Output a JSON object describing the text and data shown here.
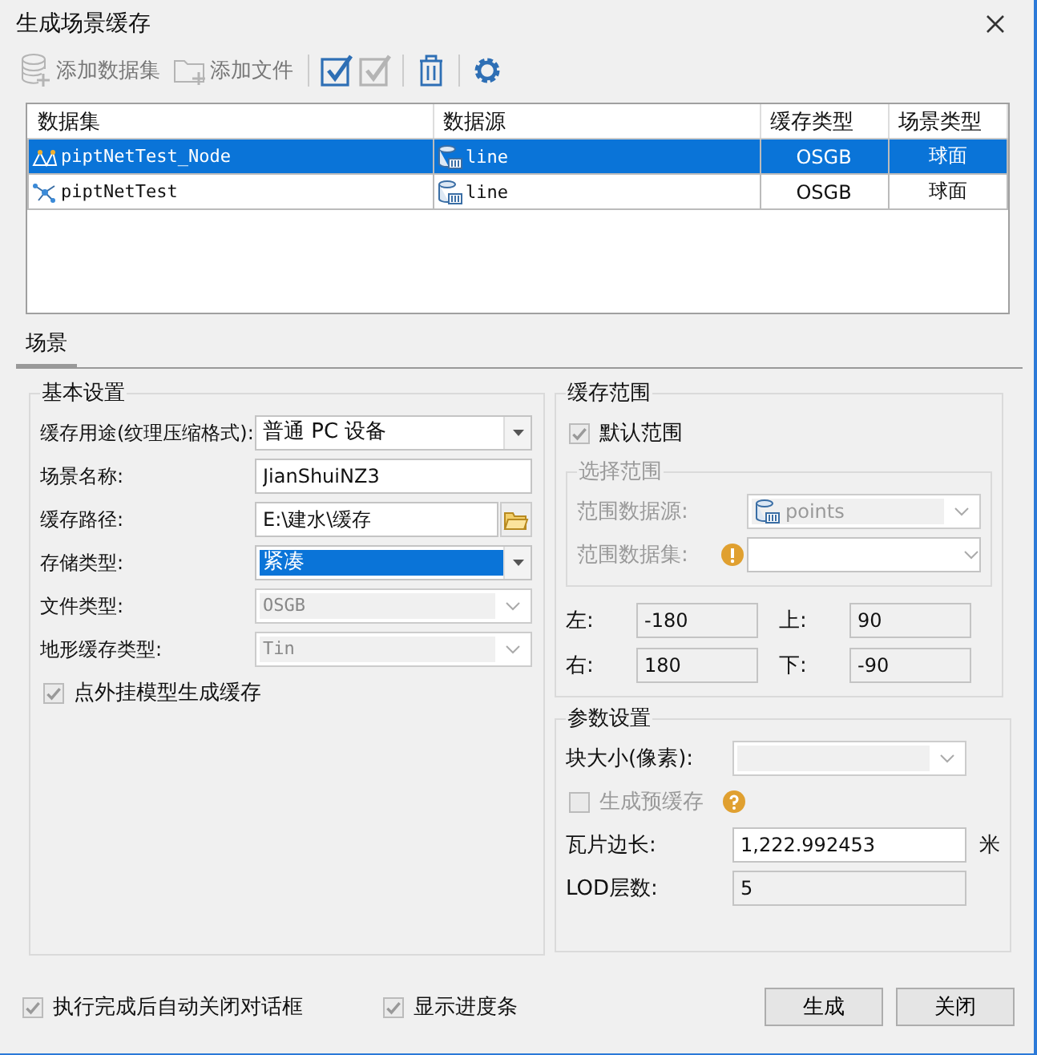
{
  "window": {
    "title": "生成场景缓存"
  },
  "toolbar": [
    {
      "kind": "add-dataset",
      "label": "添加数据集",
      "disabled": true
    },
    {
      "kind": "add-file",
      "label": "添加文件",
      "disabled": true
    },
    {
      "kind": "select-all",
      "disabled": false
    },
    {
      "kind": "invert-select",
      "disabled": true
    },
    {
      "kind": "delete",
      "disabled": false
    },
    {
      "kind": "settings",
      "disabled": false
    }
  ],
  "table": {
    "columns": [
      "数据集",
      "数据源",
      "缓存类型",
      "场景类型"
    ],
    "rows": [
      {
        "kind": "point",
        "selected": true,
        "cells": [
          "piptNetTest_Node",
          "line",
          "OSGB",
          "球面"
        ]
      },
      {
        "kind": "network",
        "selected": false,
        "cells": [
          "piptNetTest",
          "line",
          "OSGB",
          "球面"
        ]
      }
    ]
  },
  "tabs": [
    {
      "label": "场景",
      "selected": true
    }
  ],
  "basic_settings": {
    "title": "基本设置",
    "fields": [
      {
        "kind": "combo",
        "label": "缓存用途(纹理压缩格式):",
        "value": "普通 PC 设备",
        "disabled": false,
        "focused": false
      },
      {
        "kind": "text",
        "label": "场景名称:",
        "value": "JianShuiNZ3"
      },
      {
        "kind": "browse",
        "label": "缓存路径:",
        "value": "E:\\建水\\缓存"
      },
      {
        "kind": "combo",
        "label": "存储类型:",
        "value": "紧凑",
        "disabled": false,
        "focused": true
      },
      {
        "kind": "combo",
        "label": "文件类型:",
        "value": "OSGB",
        "disabled": true,
        "focused": false
      },
      {
        "kind": "combo",
        "label": "地形缓存类型:",
        "value": "Tin",
        "disabled": true,
        "focused": false
      },
      {
        "kind": "checkbox",
        "label": "点外挂模型生成缓存",
        "checked": true,
        "disabled": true
      }
    ]
  },
  "cache_extent": {
    "title": "缓存范围",
    "default_extent": {
      "label": "默认范围",
      "checked": true,
      "disabled": true
    },
    "select_range": {
      "title": "选择范围",
      "fields": [
        {
          "kind": "datasource",
          "label": "范围数据源:",
          "value": "points"
        },
        {
          "kind": "warning",
          "label": "范围数据集:"
        }
      ]
    },
    "bounds": [
      {
        "label": "左:",
        "value": "-180"
      },
      {
        "label": "上:",
        "value": "90"
      },
      {
        "label": "右:",
        "value": "180"
      },
      {
        "label": "下:",
        "value": "-90"
      }
    ]
  },
  "parameters": {
    "title": "参数设置",
    "fields": [
      {
        "kind": "combo",
        "label": "块大小(像素):",
        "disabled": true
      },
      {
        "kind": "checkbox",
        "label": "生成预缓存",
        "checked": false,
        "disabled": true,
        "help": true
      },
      {
        "kind": "text",
        "label": "瓦片边长:",
        "value": "1,222.992453",
        "unit": "米"
      },
      {
        "kind": "readonly",
        "label": "LOD层数:",
        "value": "5"
      }
    ]
  },
  "footer": {
    "options": [
      {
        "label": "执行完成后自动关闭对话框",
        "checked": true
      },
      {
        "label": "显示进度条",
        "checked": true
      }
    ],
    "buttons": [
      "生成",
      "关闭"
    ]
  }
}
